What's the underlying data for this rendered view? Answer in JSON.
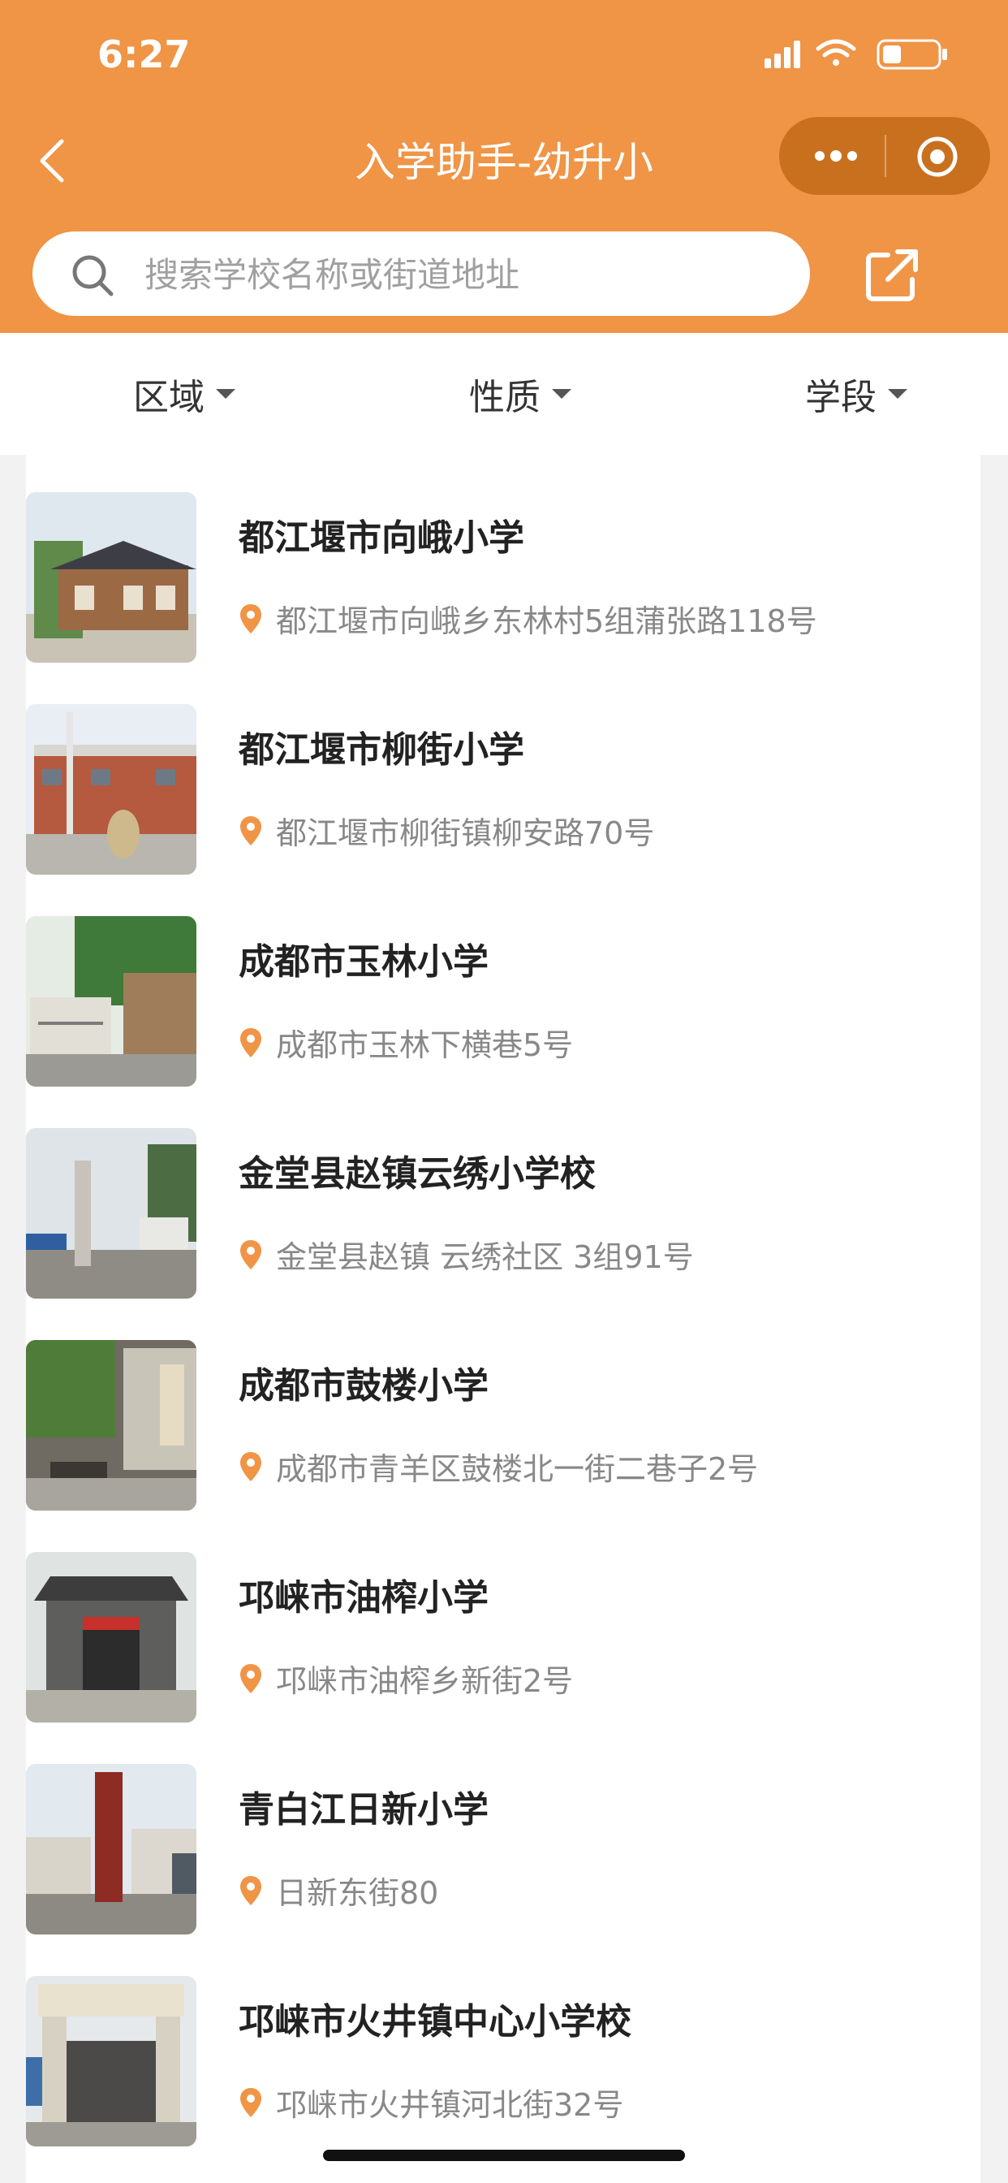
{
  "status_bar": {
    "time": "6:27"
  },
  "header": {
    "title": "入学助手-幼升小",
    "search_placeholder": "搜索学校名称或街道地址",
    "accent_color": "#f09446"
  },
  "filters": [
    {
      "label": "区域"
    },
    {
      "label": "性质"
    },
    {
      "label": "学段"
    }
  ],
  "schools": [
    {
      "name": "都江堰市向峨小学",
      "address": "都江堰市向峨乡东林村5组蒲张路118号"
    },
    {
      "name": "都江堰市柳街小学",
      "address": "都江堰市柳街镇柳安路70号"
    },
    {
      "name": "成都市玉林小学",
      "address": "成都市玉林下横巷5号"
    },
    {
      "name": "金堂县赵镇云绣小学校",
      "address": "金堂县赵镇 云绣社区 3组91号"
    },
    {
      "name": "成都市鼓楼小学",
      "address": "成都市青羊区鼓楼北一街二巷子2号"
    },
    {
      "name": "邛崃市油榨小学",
      "address": "邛崃市油榨乡新街2号"
    },
    {
      "name": "青白江日新小学",
      "address": "日新东街80"
    },
    {
      "name": "邛崃市火井镇中心小学校",
      "address": "邛崃市火井镇河北街32号"
    }
  ],
  "icons": {
    "back": "chevron-left-icon",
    "more": "more-dots-icon",
    "target": "target-icon",
    "search": "search-icon",
    "share": "share-icon",
    "pin": "location-pin-icon"
  }
}
